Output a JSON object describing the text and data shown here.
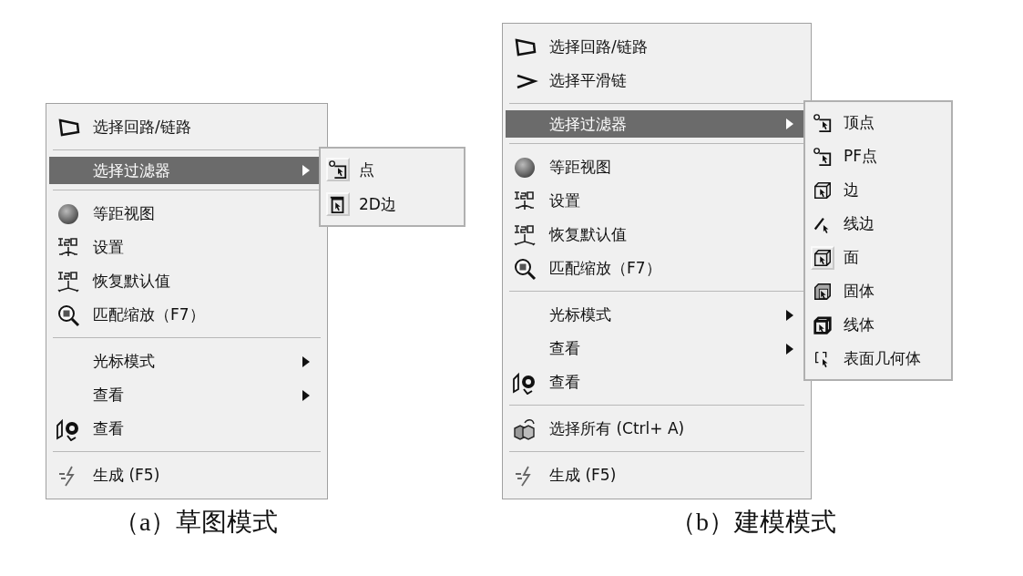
{
  "figures": [
    {
      "menu": {
        "items": [
          {
            "kind": "command",
            "label": "选择回路/链路"
          },
          {
            "kind": "separator"
          },
          {
            "kind": "submenu",
            "label": "选择过滤器",
            "selected": true
          },
          {
            "kind": "separator"
          },
          {
            "kind": "command",
            "label": "等距视图"
          },
          {
            "kind": "command",
            "label": "设置"
          },
          {
            "kind": "command",
            "label": "恢复默认值"
          },
          {
            "kind": "command",
            "label": "匹配缩放（F7）"
          },
          {
            "kind": "separator"
          },
          {
            "kind": "submenu",
            "label": "光标模式",
            "selected": false
          },
          {
            "kind": "submenu",
            "label": "查看",
            "selected": false
          },
          {
            "kind": "command",
            "label": "查看"
          },
          {
            "kind": "separator"
          },
          {
            "kind": "command",
            "label": "生成 (F5)"
          }
        ]
      },
      "submenu": {
        "items": [
          {
            "label": "点",
            "checked": true
          },
          {
            "label": "2D边",
            "checked": true
          }
        ]
      },
      "caption": "（a）草图模式"
    },
    {
      "menu": {
        "items": [
          {
            "kind": "command",
            "label": "选择回路/链路"
          },
          {
            "kind": "command",
            "label": "选择平滑链"
          },
          {
            "kind": "separator"
          },
          {
            "kind": "submenu",
            "label": "选择过滤器",
            "selected": true
          },
          {
            "kind": "separator"
          },
          {
            "kind": "command",
            "label": "等距视图"
          },
          {
            "kind": "command",
            "label": "设置"
          },
          {
            "kind": "command",
            "label": "恢复默认值"
          },
          {
            "kind": "command",
            "label": "匹配缩放（F7）"
          },
          {
            "kind": "separator"
          },
          {
            "kind": "submenu",
            "label": "光标模式",
            "selected": false
          },
          {
            "kind": "submenu",
            "label": "查看",
            "selected": false
          },
          {
            "kind": "command",
            "label": "查看"
          },
          {
            "kind": "separator"
          },
          {
            "kind": "command",
            "label": "选择所有 (Ctrl+ A)"
          },
          {
            "kind": "separator"
          },
          {
            "kind": "command",
            "label": "生成 (F5)"
          }
        ]
      },
      "submenu": {
        "items": [
          {
            "label": "顶点",
            "checked": false
          },
          {
            "label": "PF点",
            "checked": false
          },
          {
            "label": "边",
            "checked": false
          },
          {
            "label": "线边",
            "checked": false
          },
          {
            "label": "面",
            "checked": true
          },
          {
            "label": "固体",
            "checked": false
          },
          {
            "label": "线体",
            "checked": false
          },
          {
            "label": "表面几何体",
            "checked": false
          }
        ]
      },
      "caption": "（b）建模模式"
    }
  ]
}
